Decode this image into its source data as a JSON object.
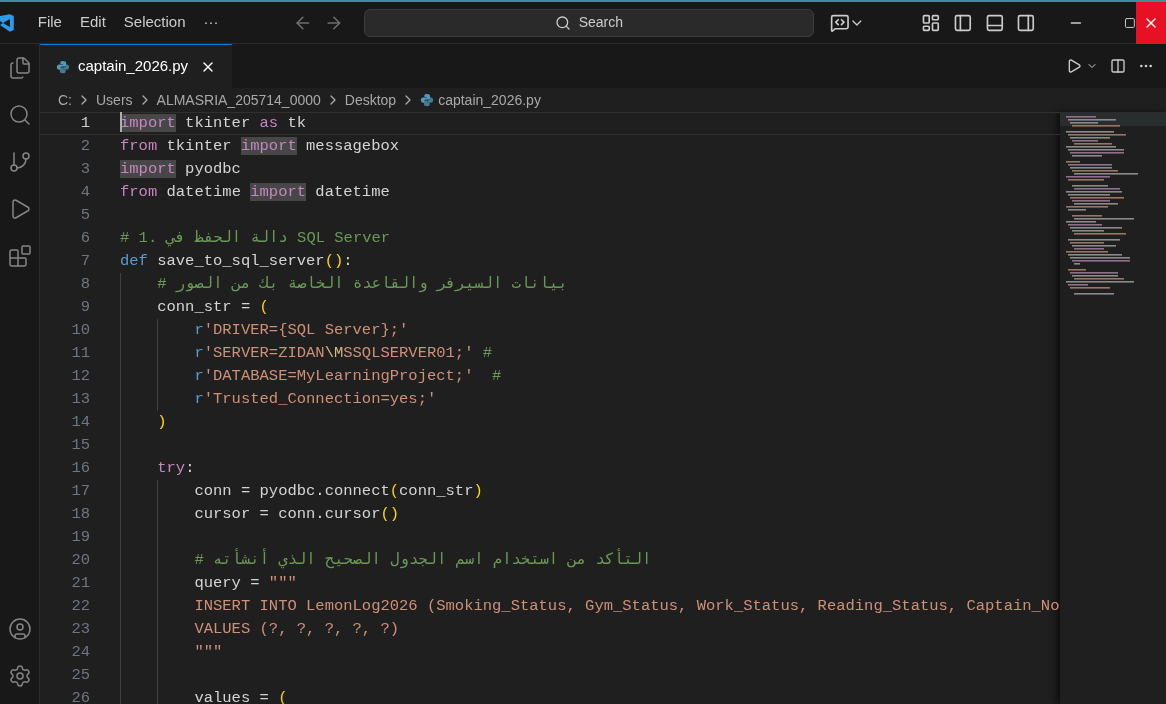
{
  "menu": [
    "File",
    "Edit",
    "Selection",
    "···"
  ],
  "search": {
    "placeholder": "Search"
  },
  "tabs": [
    {
      "label": "captain_2026.py",
      "selected": true
    }
  ],
  "breadcrumb": [
    "C:",
    "Users",
    "ALMASRIA_205714_0000",
    "Desktop",
    "captain_2026.py"
  ],
  "lines": [
    {
      "number": "1",
      "current": true,
      "tokens": [
        {
          "t": "import",
          "kind": "control",
          "highlighted": true
        },
        {
          "t": " tkinter ",
          "kind": "plain"
        },
        {
          "t": "as",
          "kind": "control"
        },
        {
          "t": " tk",
          "kind": "plain"
        }
      ]
    },
    {
      "number": "2",
      "current": false,
      "tokens": [
        {
          "t": "from",
          "kind": "control"
        },
        {
          "t": " tkinter ",
          "kind": "plain"
        },
        {
          "t": "import",
          "kind": "control",
          "highlighted": true
        },
        {
          "t": " messagebox",
          "kind": "plain"
        }
      ]
    },
    {
      "number": "3",
      "current": false,
      "tokens": [
        {
          "t": "import",
          "kind": "control",
          "highlighted": true
        },
        {
          "t": " pyodbc",
          "kind": "plain"
        }
      ]
    },
    {
      "number": "4",
      "current": false,
      "tokens": [
        {
          "t": "from",
          "kind": "control"
        },
        {
          "t": " datetime ",
          "kind": "plain"
        },
        {
          "t": "import",
          "kind": "control",
          "highlighted": true
        },
        {
          "t": " datetime",
          "kind": "plain"
        }
      ]
    },
    {
      "number": "5",
      "current": false
    },
    {
      "number": "6",
      "current": false,
      "tokens": [
        {
          "t": "# 1. دالة الحفظ في SQL Server",
          "kind": "comment"
        }
      ]
    },
    {
      "number": "7",
      "current": false,
      "tokens": [
        {
          "t": "def",
          "kind": "keyword"
        },
        {
          "t": " save_to_sql_server",
          "kind": "plain"
        },
        {
          "t": "()",
          "kind": "bracket"
        },
        {
          "t": ":",
          "kind": "plain"
        }
      ]
    },
    {
      "number": "8",
      "current": false,
      "tokens": [
        {
          "t": "    # بيانات السيرفر والقاعدة الخاصة بك من الصور",
          "kind": "comment"
        }
      ]
    },
    {
      "number": "9",
      "current": false,
      "tokens": [
        {
          "t": "    conn_str = ",
          "kind": "plain"
        },
        {
          "t": "(",
          "kind": "bracket"
        }
      ]
    },
    {
      "number": "10",
      "current": false,
      "tokens": [
        {
          "t": "        r",
          "kind": "keyword"
        },
        {
          "t": "'DRIVER={SQL Server};'",
          "kind": "string"
        }
      ]
    },
    {
      "number": "11",
      "current": false,
      "tokens": [
        {
          "t": "        r",
          "kind": "keyword"
        },
        {
          "t": "'SERVER=ZIDAN",
          "kind": "string"
        },
        {
          "t": "\\M",
          "kind": "escape"
        },
        {
          "t": "SSQLSERVER01;'",
          "kind": "string"
        },
        {
          "t": " #",
          "kind": "comment"
        }
      ]
    },
    {
      "number": "12",
      "current": false,
      "tokens": [
        {
          "t": "        r",
          "kind": "keyword"
        },
        {
          "t": "'DATABASE=MyLearningProject;'",
          "kind": "string"
        },
        {
          "t": "  #",
          "kind": "comment"
        }
      ]
    },
    {
      "number": "13",
      "current": false,
      "tokens": [
        {
          "t": "        r",
          "kind": "keyword"
        },
        {
          "t": "'Trusted_Connection=yes;'",
          "kind": "string"
        }
      ]
    },
    {
      "number": "14",
      "current": false,
      "tokens": [
        {
          "t": "    )",
          "kind": "bracket"
        }
      ]
    },
    {
      "number": "15",
      "current": false
    },
    {
      "number": "16",
      "current": false,
      "tokens": [
        {
          "t": "    try",
          "kind": "control"
        },
        {
          "t": ":",
          "kind": "plain"
        }
      ]
    },
    {
      "number": "17",
      "current": false,
      "tokens": [
        {
          "t": "        conn = pyodbc.connect",
          "kind": "plain"
        },
        {
          "t": "(",
          "kind": "bracket"
        },
        {
          "t": "conn_str",
          "kind": "plain"
        },
        {
          "t": ")",
          "kind": "bracket"
        }
      ]
    },
    {
      "number": "18",
      "current": false,
      "tokens": [
        {
          "t": "        cursor = conn.cursor",
          "kind": "plain"
        },
        {
          "t": "()",
          "kind": "bracket"
        }
      ]
    },
    {
      "number": "19",
      "current": false
    },
    {
      "number": "20",
      "current": false,
      "tokens": [
        {
          "t": "        # التأكد من استخدام اسم الجدول الصحيح الذي أنشأته",
          "kind": "comment"
        }
      ]
    },
    {
      "number": "21",
      "current": false,
      "tokens": [
        {
          "t": "        query = ",
          "kind": "plain"
        },
        {
          "t": "\"\"\"",
          "kind": "string"
        }
      ]
    },
    {
      "number": "22",
      "current": false,
      "tokens": [
        {
          "t": "        INSERT INTO LemonLog2026 (Smoking_Status, Gym_Status, Work_Status, Reading_Status, Captain_No",
          "kind": "string"
        }
      ]
    },
    {
      "number": "23",
      "current": false,
      "tokens": [
        {
          "t": "        VALUES (?, ?, ?, ?, ?)",
          "kind": "string"
        }
      ]
    },
    {
      "number": "24",
      "current": false,
      "tokens": [
        {
          "t": "        \"\"\"",
          "kind": "string"
        }
      ]
    },
    {
      "number": "25",
      "current": false
    },
    {
      "number": "26",
      "current": false,
      "tokens": [
        {
          "t": "        values = ",
          "kind": "plain"
        },
        {
          "t": "(",
          "kind": "bracket"
        }
      ]
    }
  ]
}
